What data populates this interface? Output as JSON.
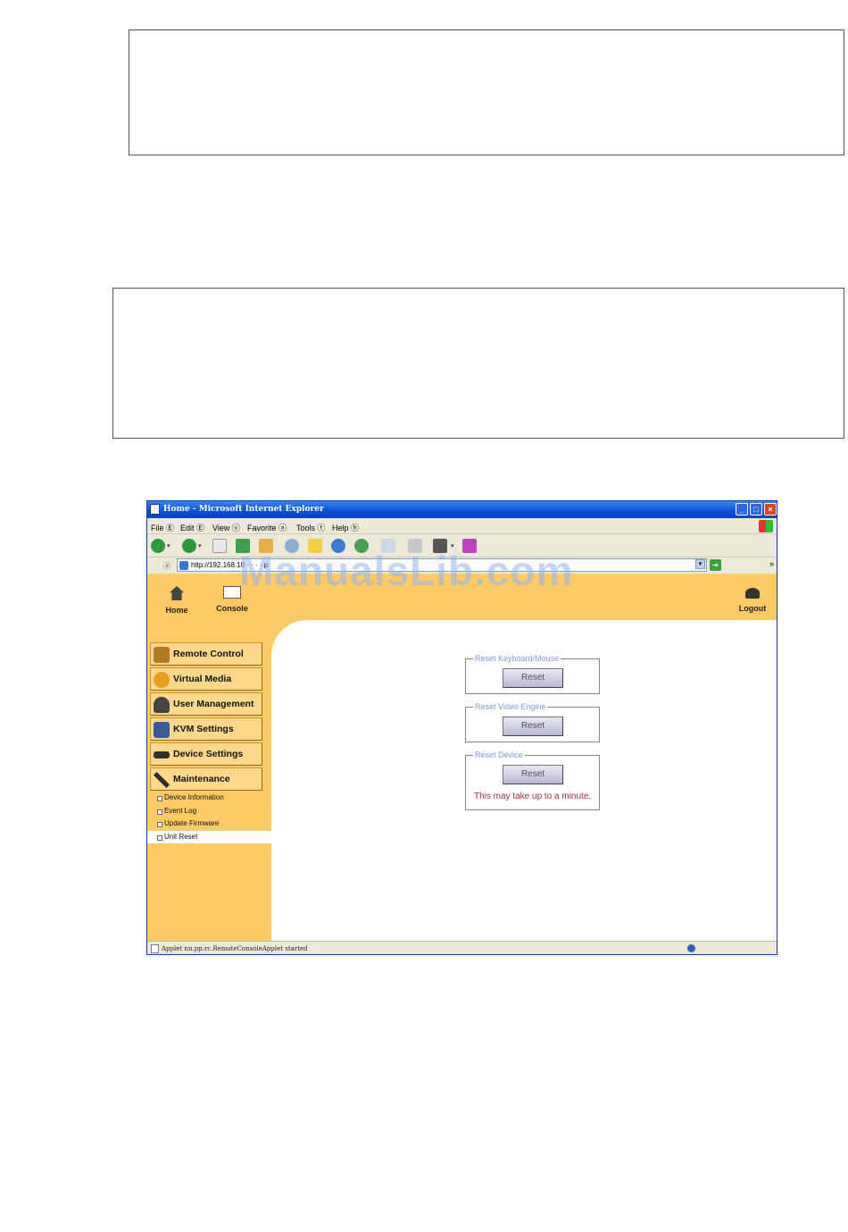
{
  "browser": {
    "title": "Home - Microsoft Internet Explorer",
    "menu": [
      "File Ⓔ",
      "Edit Ⓔ",
      "View ⓥ",
      "Favorite ⓐ",
      "Tools ⓣ",
      "Help ⓗ"
    ],
    "address_label": "ⓓ",
    "address": "http://192.168.10  · · · · p",
    "status": "Applet nn.pp.rc.RemoteConsoleApplet started"
  },
  "topnav": {
    "home": "Home",
    "console": "Console",
    "logout": "Logout"
  },
  "sidebar": {
    "menu": [
      {
        "label": "Remote Control",
        "icon": "remote-control-icon",
        "color": "#b07a20"
      },
      {
        "label": "Virtual Media",
        "icon": "virtual-media-icon",
        "color": "#e8a020"
      },
      {
        "label": "User Management",
        "icon": "user-management-icon",
        "color": "#444444"
      },
      {
        "label": "KVM Settings",
        "icon": "kvm-settings-icon",
        "color": "#3a5a9a"
      },
      {
        "label": "Device Settings",
        "icon": "device-settings-icon",
        "color": "#333333"
      },
      {
        "label": "Maintenance",
        "icon": "maintenance-icon",
        "color": "#2a2a2a"
      }
    ],
    "submenu": [
      "Device Information",
      "Event Log",
      "Update Firmware",
      "Unit Reset"
    ]
  },
  "reset_panels": [
    {
      "legend": "Reset Keyboard/Mouse",
      "button": "Reset"
    },
    {
      "legend": "Reset Video Engine",
      "button": "Reset"
    },
    {
      "legend": "Reset Device",
      "button": "Reset",
      "note": "This may take up to a minute."
    }
  ],
  "watermark": "ManualsLib.com",
  "colors": {
    "nav_bg": "#fccb63",
    "legend": "#7b9ad8",
    "note": "#a03040"
  }
}
